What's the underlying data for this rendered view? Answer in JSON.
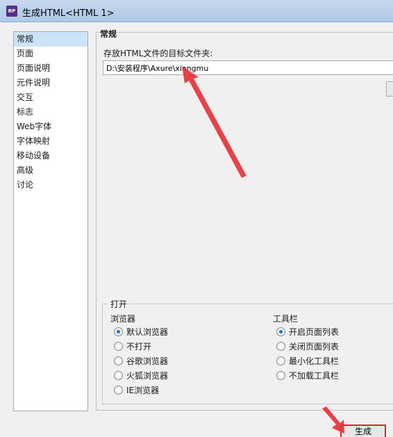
{
  "window": {
    "icon_text": "RP",
    "title": "生成HTML<HTML 1>"
  },
  "sidebar": {
    "items": [
      {
        "label": "常规",
        "selected": true
      },
      {
        "label": "页面"
      },
      {
        "label": "页面说明"
      },
      {
        "label": "元件说明"
      },
      {
        "label": "交互"
      },
      {
        "label": "标志"
      },
      {
        "label": "Web字体"
      },
      {
        "label": "字体映射"
      },
      {
        "label": "移动设备"
      },
      {
        "label": "高级"
      },
      {
        "label": "讨论"
      }
    ]
  },
  "general": {
    "section_title": "常规",
    "folder_label": "存放HTML文件的目标文件夹:",
    "folder_value": "D:\\安装程序\\Axure\\xiangmu"
  },
  "open": {
    "group_title": "打开",
    "browser": {
      "title": "浏览器",
      "options": [
        {
          "label": "默认浏览器",
          "checked": true
        },
        {
          "label": "不打开"
        },
        {
          "label": "谷歌浏览器"
        },
        {
          "label": "火狐浏览器"
        },
        {
          "label": "IE浏览器"
        }
      ]
    },
    "toolbar": {
      "title": "工具栏",
      "options": [
        {
          "label": "开启页面列表",
          "checked": true
        },
        {
          "label": "关闭页面列表"
        },
        {
          "label": "最小化工具栏"
        },
        {
          "label": "不加载工具栏"
        }
      ]
    }
  },
  "footer": {
    "generate_label": "生成"
  },
  "colors": {
    "annotation": "#e8323b"
  }
}
